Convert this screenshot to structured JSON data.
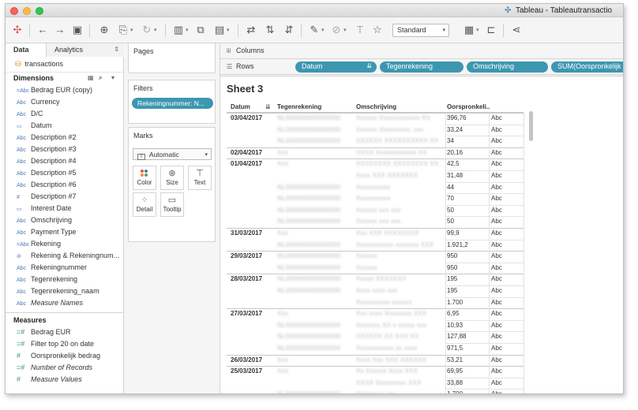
{
  "window": {
    "title": "Tableau - Tableautransactio"
  },
  "toolbar": {
    "view_mode": "Standard"
  },
  "data_pane": {
    "tab_data": "Data",
    "tab_analytics": "Analytics",
    "datasource": "transactions",
    "dimensions_heading": "Dimensions",
    "dimensions": [
      {
        "type": "=Abc",
        "label": "Bedrag EUR (copy)",
        "italic": false
      },
      {
        "type": "Abc",
        "label": "Currency",
        "italic": false
      },
      {
        "type": "Abc",
        "label": "D/C",
        "italic": false
      },
      {
        "type": "date",
        "label": "Datum",
        "italic": false
      },
      {
        "type": "Abc",
        "label": "Description #2",
        "italic": false
      },
      {
        "type": "Abc",
        "label": "Description #3",
        "italic": false
      },
      {
        "type": "Abc",
        "label": "Description #4",
        "italic": false
      },
      {
        "type": "Abc",
        "label": "Description #5",
        "italic": false
      },
      {
        "type": "Abc",
        "label": "Description #6",
        "italic": false
      },
      {
        "type": "#",
        "label": "Description #7",
        "italic": false
      },
      {
        "type": "date",
        "label": "Interest Date",
        "italic": false
      },
      {
        "type": "Abc",
        "label": "Omschrijving",
        "italic": false
      },
      {
        "type": "Abc",
        "label": "Payment Type",
        "italic": false
      },
      {
        "type": "=Abc",
        "label": "Rekening",
        "italic": false
      },
      {
        "type": "link",
        "label": "Rekening & Rekeningnum...",
        "italic": false
      },
      {
        "type": "Abc",
        "label": "Rekeningnummer",
        "italic": false
      },
      {
        "type": "Abc",
        "label": "Tegenrekening",
        "italic": false
      },
      {
        "type": "Abc",
        "label": "Tegenrekening_naam",
        "italic": false
      },
      {
        "type": "Abc",
        "label": "Measure Names",
        "italic": true
      }
    ],
    "measures_heading": "Measures",
    "measures": [
      {
        "type": "=#",
        "label": "Bedrag EUR",
        "italic": false
      },
      {
        "type": "=#",
        "label": "Filter top 20 on date",
        "italic": false
      },
      {
        "type": "#",
        "label": "Oorspronkelijk bedrag",
        "italic": false
      },
      {
        "type": "=#",
        "label": "Number of Records",
        "italic": true
      },
      {
        "type": "#",
        "label": "Measure Values",
        "italic": true
      }
    ]
  },
  "cards": {
    "pages": "Pages",
    "filters": "Filters",
    "filter_pill": "Rekeningnummer: N...",
    "marks": "Marks",
    "mark_type": "Automatic",
    "buttons": [
      "Color",
      "Size",
      "Text",
      "Detail",
      "Tooltip"
    ]
  },
  "shelves": {
    "columns_label": "Columns",
    "rows_label": "Rows",
    "rows_pills": [
      "Datum",
      "Tegenrekening",
      "Omschrijving",
      "SUM(Oorspronkelijk b"
    ]
  },
  "view": {
    "sheet_title": "Sheet 3",
    "headers": [
      "Datum",
      "Tegenrekening",
      "Omschrijving",
      "Oorspronkeli.."
    ],
    "rows": [
      {
        "datum": "03/04/2017",
        "tegen": "NL000000000000000",
        "omsch": "Xxxxxx Xxxxxxxxxxxx XX",
        "amount": "396,76",
        "abc": "Abc"
      },
      {
        "datum": "",
        "tegen": "NL000000000000000",
        "omsch": "Xxxxxx Xxxxxxxxx, xxx",
        "amount": "33,24",
        "abc": "Abc"
      },
      {
        "datum": "",
        "tegen": "NL000000000000000",
        "omsch": "XXXXXX XXXXXXXXXX XX",
        "amount": "34",
        "abc": "Abc"
      },
      {
        "datum": "02/04/2017",
        "tegen": "Xxx",
        "omsch": "XXXX Xxxxxxxxxxxx XX",
        "amount": "20,16",
        "abc": "Abc"
      },
      {
        "datum": "01/04/2017",
        "tegen": "Xxx",
        "omsch": "XXXXXXXX XXXXXXXX XX",
        "amount": "42,5",
        "abc": "Abc"
      },
      {
        "datum": "",
        "tegen": "",
        "omsch": "Xxxx XXX XXXXXXX",
        "amount": "31,48",
        "abc": "Abc"
      },
      {
        "datum": "",
        "tegen": "NL000000000000000",
        "omsch": "Xxxxxxxxxx",
        "amount": "44",
        "abc": "Abc"
      },
      {
        "datum": "",
        "tegen": "NL000000000000000",
        "omsch": "Xxxxxxxxxx",
        "amount": "70",
        "abc": "Abc"
      },
      {
        "datum": "",
        "tegen": "NL000000000000000",
        "omsch": "Xxxxxx xxx xxx",
        "amount": "50",
        "abc": "Abc"
      },
      {
        "datum": "",
        "tegen": "NL000000000000000",
        "omsch": "Xxxxxx xxx xxx",
        "amount": "50",
        "abc": "Abc"
      },
      {
        "datum": "31/03/2017",
        "tegen": "Xxx",
        "omsch": "Xxx XXX XXXXXXXX",
        "amount": "99,9",
        "abc": "Abc"
      },
      {
        "datum": "",
        "tegen": "NL000000000000000",
        "omsch": "Xxxxxxxxxxx xxxxxxx XXX",
        "amount": "1.921,2",
        "abc": "Abc"
      },
      {
        "datum": "29/03/2017",
        "tegen": "NL000000000000000",
        "omsch": "Xxxxxx",
        "amount": "950",
        "abc": "Abc"
      },
      {
        "datum": "",
        "tegen": "NL000000000000000",
        "omsch": "Xxxxxx",
        "amount": "950",
        "abc": "Abc"
      },
      {
        "datum": "28/03/2017",
        "tegen": "NL000000000000000",
        "omsch": "Xxxxx XXXXXXX",
        "amount": "195",
        "abc": "Abc"
      },
      {
        "datum": "",
        "tegen": "NL000000000000000",
        "omsch": "Xxxx xxxx xxx",
        "amount": "195",
        "abc": "Abc"
      },
      {
        "datum": "",
        "tegen": "",
        "omsch": "Xxxxxxxxxx xxxxxx",
        "amount": "1.700",
        "abc": "Abc"
      },
      {
        "datum": "27/03/2017",
        "tegen": "Xxx",
        "omsch": "Xxx xxxx Xxxxxxxx XXX",
        "amount": "6,95",
        "abc": "Abc"
      },
      {
        "datum": "",
        "tegen": "NL000000000000000",
        "omsch": "Xxxxxxx XX x xxxxx xxx",
        "amount": "10,93",
        "abc": "Abc"
      },
      {
        "datum": "",
        "tegen": "NL000000000000000",
        "omsch": "XXXXXX XX XXX XX",
        "amount": "127,88",
        "abc": "Abc"
      },
      {
        "datum": "",
        "tegen": "NL000000000000000",
        "omsch": "Xxxxxxxxxxx xx xxxx",
        "amount": "971,5",
        "abc": "Abc"
      },
      {
        "datum": "26/03/2017",
        "tegen": "Xxx",
        "omsch": "Xxxx Xxx XXX XXXXXX",
        "amount": "53,21",
        "abc": "Abc"
      },
      {
        "datum": "25/03/2017",
        "tegen": "Xxx",
        "omsch": "Xx Xxxxxx Xxxx XXX",
        "amount": "69,95",
        "abc": "Abc"
      },
      {
        "datum": "",
        "tegen": "",
        "omsch": "XXXX Xxxxxxxxx XXX",
        "amount": "33,88",
        "abc": "Abc"
      },
      {
        "datum": "",
        "tegen": "NL000000000000000",
        "omsch": "Xxxxxxxx xxx",
        "amount": "1.700",
        "abc": "Abc"
      }
    ]
  }
}
